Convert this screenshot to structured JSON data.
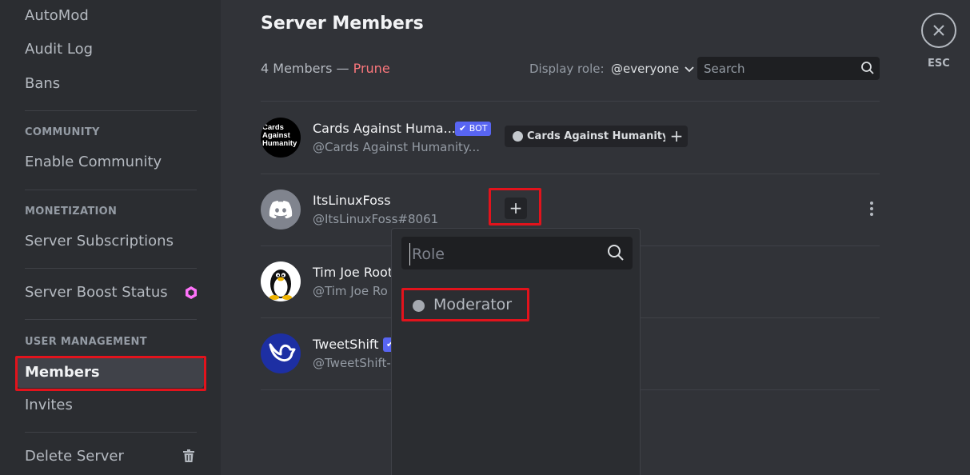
{
  "sidebar": {
    "items_top": [
      "AutoMod",
      "Audit Log",
      "Bans"
    ],
    "community": {
      "header": "COMMUNITY",
      "item": "Enable Community"
    },
    "monetization": {
      "header": "MONETIZATION",
      "item": "Server Subscriptions"
    },
    "boost": {
      "item": "Server Boost Status"
    },
    "user_management": {
      "header": "USER MANAGEMENT",
      "members": "Members",
      "invites": "Invites"
    },
    "delete": "Delete Server"
  },
  "main": {
    "title": "Server Members",
    "count": "4 Members — ",
    "prune": "Prune",
    "display_role_label": "Display role:",
    "display_role_value": "@everyone",
    "search_placeholder": "Search"
  },
  "members": [
    {
      "name": "Cards Against Huma...",
      "tag": "@Cards Against Humanity...",
      "badge": "✔ BOT",
      "role": "Cards Against Humanity",
      "avatar_text": "Cards Against Humanity"
    },
    {
      "name": "ItsLinuxFoss",
      "tag": "@ItsLinuxFoss#8061"
    },
    {
      "name": "Tim Joe Root",
      "tag": "@Tim Joe Ro"
    },
    {
      "name": "TweetShift",
      "tag": "@TweetShift-"
    }
  ],
  "role_popout": {
    "placeholder": "Role",
    "options": [
      "Moderator"
    ]
  },
  "close": {
    "label": "ESC"
  },
  "colors": {
    "accent": "#5865f2",
    "highlight": "#e2131c",
    "prune": "#fa777c",
    "boost": "#ff73fa"
  }
}
